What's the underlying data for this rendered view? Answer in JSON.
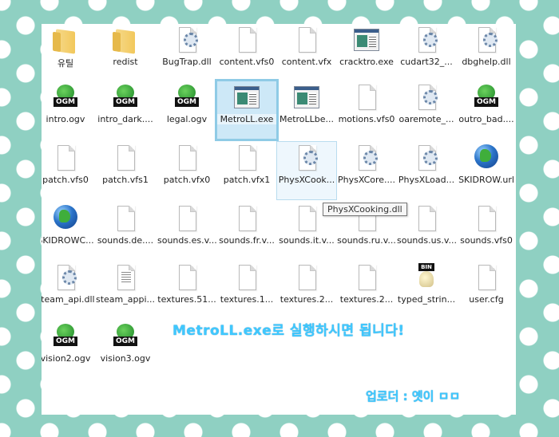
{
  "files": [
    {
      "label": "유틸",
      "icon": "folder-icon"
    },
    {
      "label": "redist",
      "icon": "folder-icon"
    },
    {
      "label": "BugTrap.dll",
      "icon": "dll-gear-icon"
    },
    {
      "label": "content.vfs0",
      "icon": "blank-file-icon"
    },
    {
      "label": "content.vfx",
      "icon": "blank-file-icon"
    },
    {
      "label": "cracktro.exe",
      "icon": "application-icon"
    },
    {
      "label": "cudart32_...",
      "icon": "dll-gear-icon"
    },
    {
      "label": "dbghelp.dll",
      "icon": "dll-gear-icon"
    },
    {
      "label": "intro.ogv",
      "icon": "ogm-video-icon"
    },
    {
      "label": "intro_dark....",
      "icon": "ogm-video-icon"
    },
    {
      "label": "legal.ogv",
      "icon": "ogm-video-icon"
    },
    {
      "label": "MetroLL.exe",
      "icon": "application-icon",
      "selected": true
    },
    {
      "label": "MetroLLbe...",
      "icon": "application-icon"
    },
    {
      "label": "motions.vfs0",
      "icon": "blank-file-icon"
    },
    {
      "label": "oaremote_...",
      "icon": "dll-gear-icon"
    },
    {
      "label": "outro_bad....",
      "icon": "ogm-video-icon"
    },
    {
      "label": "patch.vfs0",
      "icon": "blank-file-icon"
    },
    {
      "label": "patch.vfs1",
      "icon": "blank-file-icon"
    },
    {
      "label": "patch.vfx0",
      "icon": "blank-file-icon"
    },
    {
      "label": "patch.vfx1",
      "icon": "blank-file-icon"
    },
    {
      "label": "PhysXCook...",
      "icon": "dll-gear-icon",
      "hover": true
    },
    {
      "label": "PhysXCore....",
      "icon": "dll-gear-icon"
    },
    {
      "label": "PhysXLoad...",
      "icon": "dll-gear-icon"
    },
    {
      "label": "SKIDROW.url",
      "icon": "globe-icon"
    },
    {
      "label": "SKIDROWC...",
      "icon": "globe-icon"
    },
    {
      "label": "sounds.de....",
      "icon": "blank-file-icon"
    },
    {
      "label": "sounds.es.v...",
      "icon": "blank-file-icon"
    },
    {
      "label": "sounds.fr.v...",
      "icon": "blank-file-icon"
    },
    {
      "label": "sounds.it.v...",
      "icon": "blank-file-icon"
    },
    {
      "label": "sounds.ru.v...",
      "icon": "blank-file-icon"
    },
    {
      "label": "sounds.us.v...",
      "icon": "blank-file-icon"
    },
    {
      "label": "sounds.vfs0",
      "icon": "blank-file-icon"
    },
    {
      "label": "steam_api.dll",
      "icon": "dll-gear-icon"
    },
    {
      "label": "steam_appi...",
      "icon": "text-file-icon"
    },
    {
      "label": "textures.51...",
      "icon": "blank-file-icon"
    },
    {
      "label": "textures.1...",
      "icon": "blank-file-icon"
    },
    {
      "label": "textures.2...",
      "icon": "blank-file-icon"
    },
    {
      "label": "textures.2...",
      "icon": "blank-file-icon"
    },
    {
      "label": "typed_strin...",
      "icon": "bin-file-icon"
    },
    {
      "label": "user.cfg",
      "icon": "blank-file-icon"
    },
    {
      "label": "vision2.ogv",
      "icon": "ogm-video-icon"
    },
    {
      "label": "vision3.ogv",
      "icon": "ogm-video-icon"
    }
  ],
  "icon_text": {
    "ogm": "OGM",
    "bin": "BIN"
  },
  "tooltip": "PhysXCooking.dll",
  "note": "MetroLL.exe로 실행하시면 됩니다!",
  "uploader": "업로더 : 옛이 ㅁㅁ",
  "colors": {
    "background": "#8fd0c2",
    "accent_text": "#3fc8ff",
    "selection": "#8fcbe6"
  }
}
